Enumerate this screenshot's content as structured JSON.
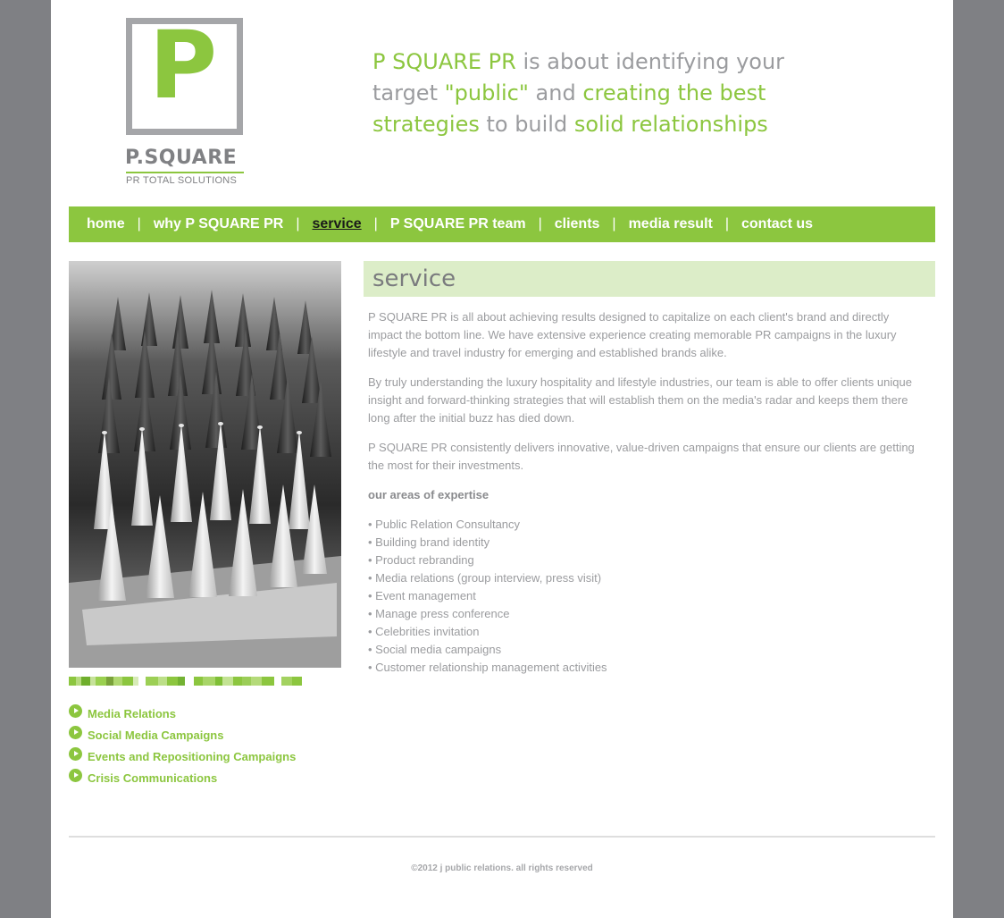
{
  "logo": {
    "mark": "P",
    "name": "P.SQUARE",
    "subtitle": "PR TOTAL SOLUTIONS"
  },
  "tagline": {
    "p1": "P SQUARE PR",
    "p2": " is about identifying your target ",
    "p3": "\"public\"",
    "p4": " and ",
    "p5": "creating the best strategies",
    "p6": " to build ",
    "p7": "solid relationships"
  },
  "nav": {
    "separator": "|",
    "items": [
      {
        "label": "home"
      },
      {
        "label": "why P SQUARE PR"
      },
      {
        "label": "service"
      },
      {
        "label": "P SQUARE PR team"
      },
      {
        "label": "clients"
      },
      {
        "label": "media result"
      },
      {
        "label": "contact us"
      }
    ]
  },
  "sidebar": {
    "links": [
      {
        "label": "Media Relations"
      },
      {
        "label": "Social Media Campaigns"
      },
      {
        "label": "Events and Repositioning Campaigns"
      },
      {
        "label": "Crisis Communications"
      }
    ]
  },
  "main": {
    "title": "service",
    "paragraphs": [
      "P SQUARE PR is all about achieving results designed to capitalize on each client's brand and directly impact the bottom line. We have extensive experience creating memorable PR campaigns in the luxury lifestyle and travel industry for emerging and established brands alike.",
      "By truly understanding the luxury hospitality and lifestyle industries, our team is able to offer clients unique insight and forward-thinking strategies that will establish them on the media's radar and keeps them there long after the initial buzz has died down.",
      "P SQUARE PR consistently delivers innovative, value-driven campaigns that ensure our clients are getting the most for their investments."
    ],
    "expertise_heading": "our areas of expertise",
    "expertise": [
      "• Public Relation Consultancy",
      "• Building brand identity",
      "• Product rebranding",
      "• Media relations (group interview, press visit)",
      "• Event management",
      "• Manage press conference",
      "• Celebrities invitation",
      "• Social media campaigns",
      "• Customer relationship management activities"
    ]
  },
  "footer": {
    "copyright": "©2012 j public relations. all rights reserved"
  },
  "colors": {
    "brand_green": "#8cc63f",
    "light_green": "#dcedc8",
    "gray_text": "#9b9c9f",
    "frame": "#7f8084"
  }
}
